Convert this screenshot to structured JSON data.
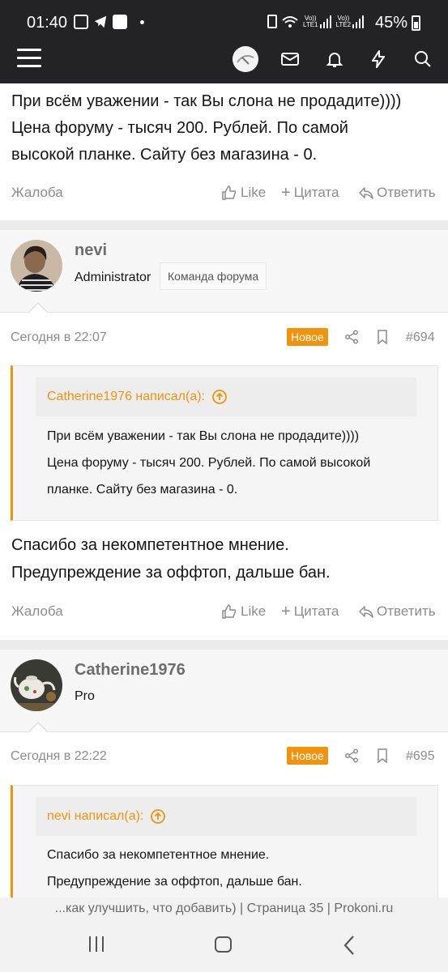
{
  "status_bar": {
    "time": "01:40",
    "lte1": "LTE1",
    "lte2": "LTE2",
    "vo": "Vo))",
    "battery": "45%"
  },
  "header": {
    "icons": [
      "menu-icon",
      "avatar",
      "mail-icon",
      "bell-icon",
      "bolt-icon",
      "search-icon"
    ]
  },
  "post1": {
    "text_lines": [
      "При всём уважении - так Вы слона не продадите))))",
      "Цена форуму - тысяч 200. Рублей. По самой",
      "высокой планке. Сайту без магазина - 0."
    ],
    "report": "Жалоба",
    "like": "Like",
    "quote": "Цитата",
    "reply": "Ответить"
  },
  "post2": {
    "username": "nevi",
    "role": "Administrator",
    "badge": "Команда форума",
    "date": "Сегодня в 22:07",
    "new_label": "Новое",
    "number": "#694",
    "quote_author": "Catherine1976 написал(а):",
    "quote_lines": [
      "При всём уважении - так Вы слона не продадите))))",
      "Цена форуму - тысяч 200. Рублей. По самой высокой",
      "планке. Сайту без магазина - 0."
    ],
    "text_lines": [
      "Спасибо за некомпетентное мнение.",
      "Предупреждение за оффтоп, дальше бан."
    ],
    "report": "Жалоба",
    "like": "Like",
    "quote": "Цитата",
    "reply": "Ответить"
  },
  "post3": {
    "username": "Catherine1976",
    "role": "Pro",
    "date": "Сегодня в 22:22",
    "new_label": "Новое",
    "number": "#695",
    "quote_author": "nevi написал(а):",
    "quote_lines": [
      "Спасибо за некомпетентное мнение.",
      "Предупреждение за оффтоп, дальше бан."
    ]
  },
  "page_title": "...как улучшить, что добавить) | Страница 35 | Prokoni.ru",
  "colors": {
    "accent": "#f2930d",
    "header_bg": "#232325",
    "muted": "#8c8c8c"
  }
}
